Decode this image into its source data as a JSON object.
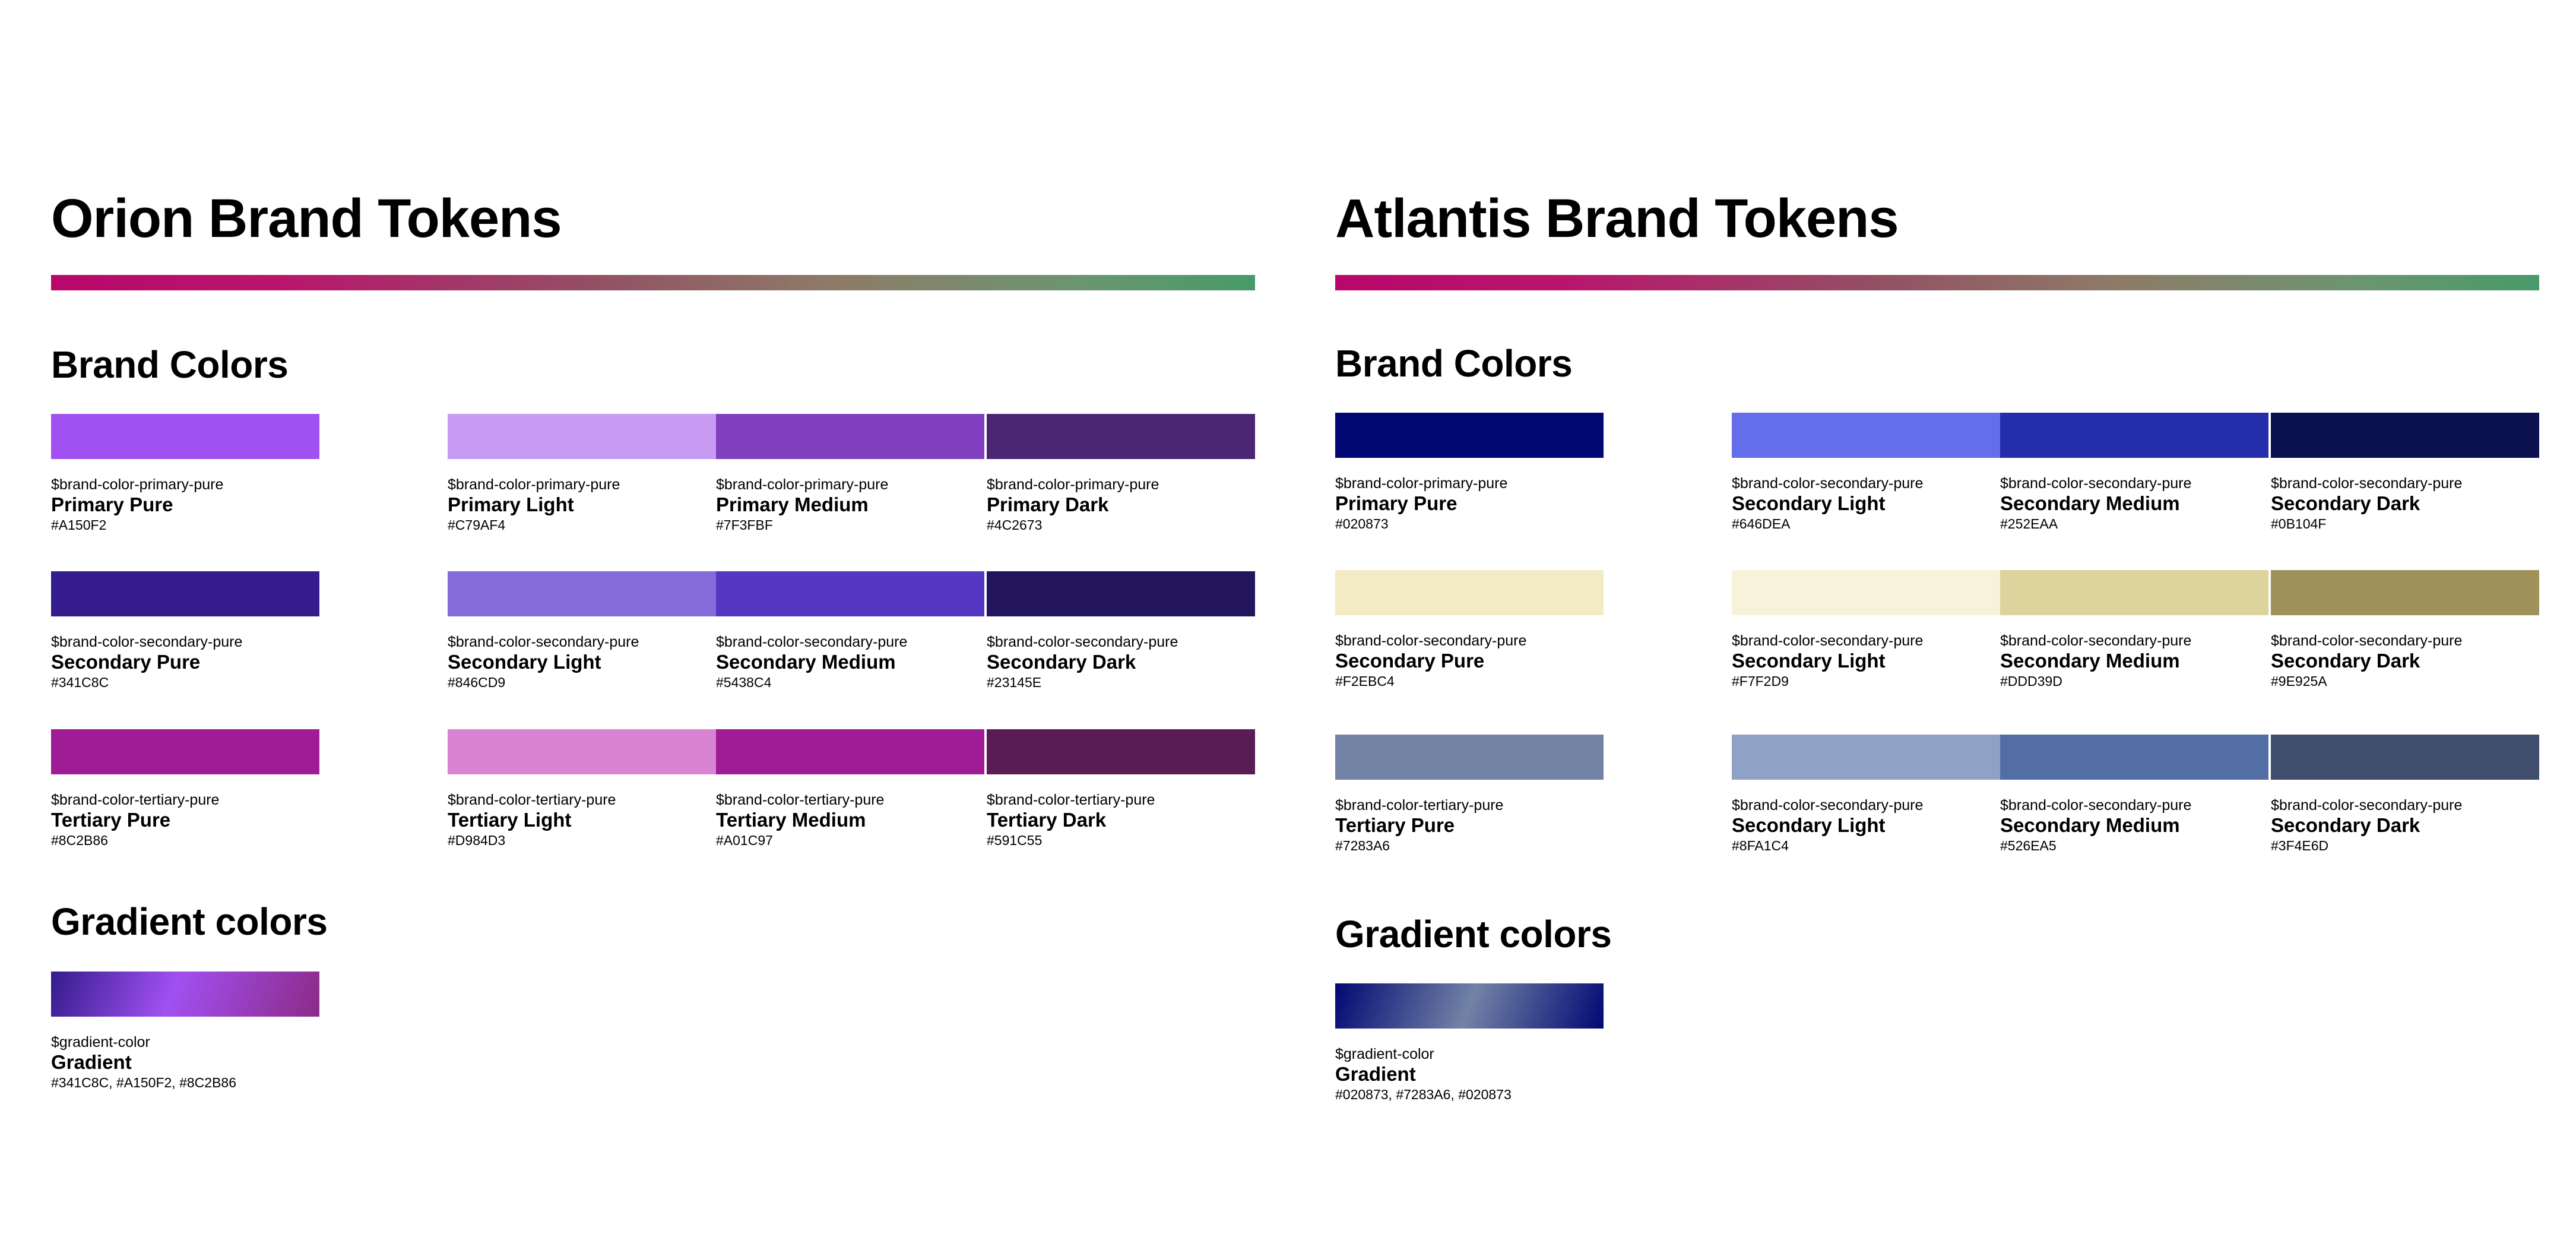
{
  "orion": {
    "title": "Orion Brand Tokens",
    "brand_colors_heading": "Brand Colors",
    "gradient_heading": "Gradient colors",
    "rows": [
      {
        "pure": {
          "token": "$brand-color-primary-pure",
          "label": "Primary Pure",
          "hex": "#A150F2",
          "color": "#A150F2"
        },
        "light": {
          "token": "$brand-color-primary-pure",
          "label": "Primary Light",
          "hex": "#C79AF4",
          "color": "#C79AF4"
        },
        "medium": {
          "token": "$brand-color-primary-pure",
          "label": "Primary Medium",
          "hex": "#7F3FBF",
          "color": "#7F3FBF"
        },
        "dark": {
          "token": "$brand-color-primary-pure",
          "label": "Primary Dark",
          "hex": "#4C2673",
          "color": "#4C2673"
        }
      },
      {
        "pure": {
          "token": "$brand-color-secondary-pure",
          "label": "Secondary Pure",
          "hex": "#341C8C",
          "color": "#341C8C"
        },
        "light": {
          "token": "$brand-color-secondary-pure",
          "label": "Secondary Light",
          "hex": "#846CD9",
          "color": "#846CD9"
        },
        "medium": {
          "token": "$brand-color-secondary-pure",
          "label": "Secondary Medium",
          "hex": "#5438C4",
          "color": "#5438C4"
        },
        "dark": {
          "token": "$brand-color-secondary-pure",
          "label": "Secondary Dark",
          "hex": "#23145E",
          "color": "#23145E"
        }
      },
      {
        "pure": {
          "token": "$brand-color-tertiary-pure",
          "label": "Tertiary Pure",
          "hex": "#8C2B86",
          "color": "#A01C97"
        },
        "light": {
          "token": "$brand-color-tertiary-pure",
          "label": "Tertiary Light",
          "hex": "#D984D3",
          "color": "#D984D3"
        },
        "medium": {
          "token": "$brand-color-tertiary-pure",
          "label": "Tertiary Medium",
          "hex": "#A01C97",
          "color": "#A01C97"
        },
        "dark": {
          "token": "$brand-color-tertiary-pure",
          "label": "Tertiary Dark",
          "hex": "#591C55",
          "color": "#591C55"
        }
      }
    ],
    "gradient": {
      "token": "$gradient-color",
      "label": "Gradient",
      "hex": "#341C8C, #A150F2, #8C2B86"
    }
  },
  "atlantis": {
    "title": "Atlantis Brand Tokens",
    "brand_colors_heading": "Brand Colors",
    "gradient_heading": "Gradient colors",
    "rows": [
      {
        "pure": {
          "token": "$brand-color-primary-pure",
          "label": "Primary Pure",
          "hex": "#020873",
          "color": "#020873"
        },
        "light": {
          "token": "$brand-color-secondary-pure",
          "label": "Secondary Light",
          "hex": "#646DEA",
          "color": "#646DEA"
        },
        "medium": {
          "token": "$brand-color-secondary-pure",
          "label": "Secondary Medium",
          "hex": "#252EAA",
          "color": "#252EAA"
        },
        "dark": {
          "token": "$brand-color-secondary-pure",
          "label": "Secondary Dark",
          "hex": "#0B104F",
          "color": "#0B104F"
        }
      },
      {
        "pure": {
          "token": "$brand-color-secondary-pure",
          "label": "Secondary Pure",
          "hex": "#F2EBC4",
          "color": "#F2EBC4"
        },
        "light": {
          "token": "$brand-color-secondary-pure",
          "label": "Secondary Light",
          "hex": "#F7F2D9",
          "color": "#F7F2D9"
        },
        "medium": {
          "token": "$brand-color-secondary-pure",
          "label": "Secondary Medium",
          "hex": "#DDD39D",
          "color": "#DDD39D"
        },
        "dark": {
          "token": "$brand-color-secondary-pure",
          "label": "Secondary Dark",
          "hex": "#9E925A",
          "color": "#9E925A"
        }
      },
      {
        "pure": {
          "token": "$brand-color-tertiary-pure",
          "label": "Tertiary Pure",
          "hex": "#7283A6",
          "color": "#7283A6"
        },
        "light": {
          "token": "$brand-color-secondary-pure",
          "label": "Secondary Light",
          "hex": "#8FA1C4",
          "color": "#8FA1C4"
        },
        "medium": {
          "token": "$brand-color-secondary-pure",
          "label": "Secondary Medium",
          "hex": "#526EA5",
          "color": "#526EA5"
        },
        "dark": {
          "token": "$brand-color-secondary-pure",
          "label": "Secondary Dark",
          "hex": "#3F4E6D",
          "color": "#3F4E6D"
        }
      }
    ],
    "gradient": {
      "token": "$gradient-color",
      "label": "Gradient",
      "hex": "#020873, #7283A6, #020873"
    }
  }
}
